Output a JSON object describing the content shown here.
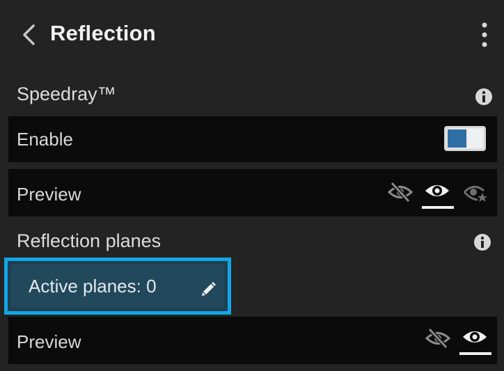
{
  "header": {
    "title": "Reflection",
    "back_icon": "chevron-left-icon",
    "more_icon": "more-vertical-icon"
  },
  "speedray": {
    "section_label": "Speedray™",
    "info_icon": "info-icon",
    "enable": {
      "label": "Enable",
      "toggled_on": true
    },
    "preview": {
      "label": "Preview",
      "icons": [
        "eye-hidden-icon",
        "eye-icon",
        "eye-star-icon"
      ],
      "selected": "eye-icon"
    }
  },
  "reflection_planes": {
    "section_label": "Reflection planes",
    "info_icon": "info-icon",
    "active_planes_label": "Active planes: 0",
    "edit_icon": "pencil-icon",
    "preview": {
      "label": "Preview",
      "icons": [
        "eye-hidden-icon",
        "eye-icon"
      ],
      "selected": "eye-icon"
    }
  },
  "colors": {
    "background": "#232323",
    "row_background": "#0b0b0b",
    "accent": "#11a7e6",
    "toggle_on": "#2f6fa3",
    "button_background": "#22485c"
  }
}
